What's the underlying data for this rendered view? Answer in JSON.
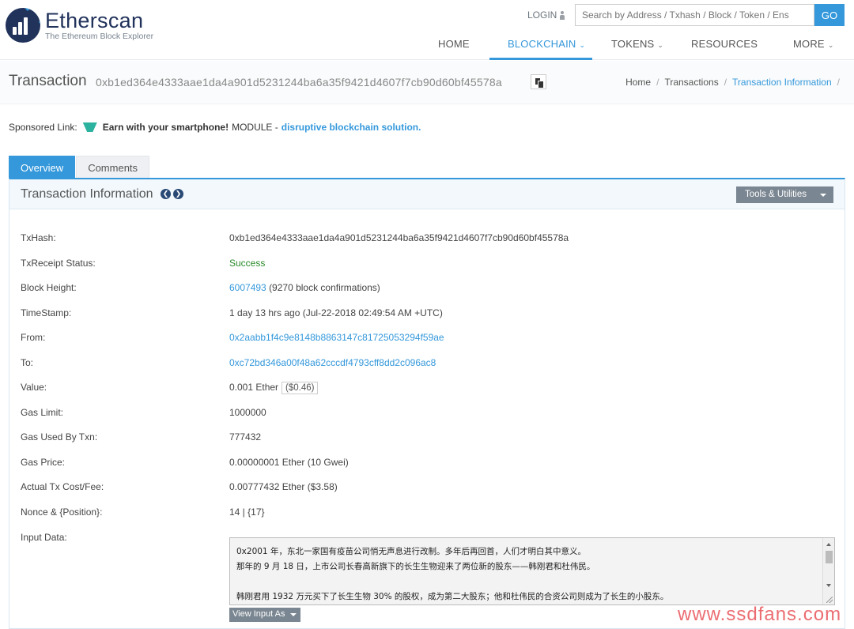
{
  "brand": {
    "name": "Etherscan",
    "tagline": "The Ethereum Block Explorer"
  },
  "header": {
    "login_label": "LOGIN",
    "search_placeholder": "Search by Address / Txhash / Block / Token / Ens",
    "go_label": "GO",
    "nav": [
      {
        "label": "HOME",
        "active": false,
        "dropdown": false
      },
      {
        "label": "BLOCKCHAIN",
        "active": true,
        "dropdown": true
      },
      {
        "label": "TOKENS",
        "active": false,
        "dropdown": true
      },
      {
        "label": "RESOURCES",
        "active": false,
        "dropdown": false
      },
      {
        "label": "MORE",
        "active": false,
        "dropdown": true
      }
    ]
  },
  "page": {
    "title": "Transaction",
    "hash": "0xb1ed364e4333aae1da4a901d5231244ba6a35f9421d4607f7cb90d60bf45578a",
    "breadcrumb": [
      "Home",
      "Transactions",
      "Transaction Information"
    ]
  },
  "sponsor": {
    "label": "Sponsored Link:",
    "bold_text": "Earn with your smartphone!",
    "brand_text": "MODULE -",
    "link_text": "disruptive blockchain solution."
  },
  "tabs": [
    {
      "label": "Overview",
      "active": true
    },
    {
      "label": "Comments",
      "active": false
    }
  ],
  "panel": {
    "title": "Transaction Information",
    "tools_label": "Tools & Utilities"
  },
  "details": {
    "txhash_label": "TxHash:",
    "txhash": "0xb1ed364e4333aae1da4a901d5231244ba6a35f9421d4607f7cb90d60bf45578a",
    "status_label": "TxReceipt Status:",
    "status": "Success",
    "block_label": "Block Height:",
    "block": "6007493",
    "block_confirmations": "(9270 block confirmations)",
    "timestamp_label": "TimeStamp:",
    "timestamp": "1 day 13 hrs ago (Jul-22-2018 02:49:54 AM +UTC)",
    "from_label": "From:",
    "from": "0x2aabb1f4c9e8148b8863147c81725053294f59ae",
    "to_label": "To:",
    "to": "0xc72bd346a00f48a62cccdf4793cff8dd2c096ac8",
    "value_label": "Value:",
    "value": "0.001 Ether",
    "value_usd": "($0.46)",
    "gas_limit_label": "Gas Limit:",
    "gas_limit": "1000000",
    "gas_used_label": "Gas Used By Txn:",
    "gas_used": "777432",
    "gas_price_label": "Gas Price:",
    "gas_price": "0.00000001 Ether (10 Gwei)",
    "fee_label": "Actual Tx Cost/Fee:",
    "fee": "0.00777432 Ether ($3.58)",
    "nonce_label": "Nonce & {Position}:",
    "nonce": "14 | {17}",
    "input_label": "Input Data:",
    "input_lines": [
      "0x2001 年，东北一家国有疫苗公司悄无声息进行改制。多年后再回首，人们才明白其中意义。",
      "那年的 9 月 18 日，上市公司长春高新旗下的长生生物迎来了两位新的股东——韩刚君和杜伟民。",
      "",
      "韩刚君用 1932 万元买下了长生生物 30% 的股权，成为第二大股东；他和杜伟民的合资公司则成为了长生的小股东。"
    ],
    "view_input_label": "View Input As"
  },
  "watermark": "www.ssdfans.com"
}
